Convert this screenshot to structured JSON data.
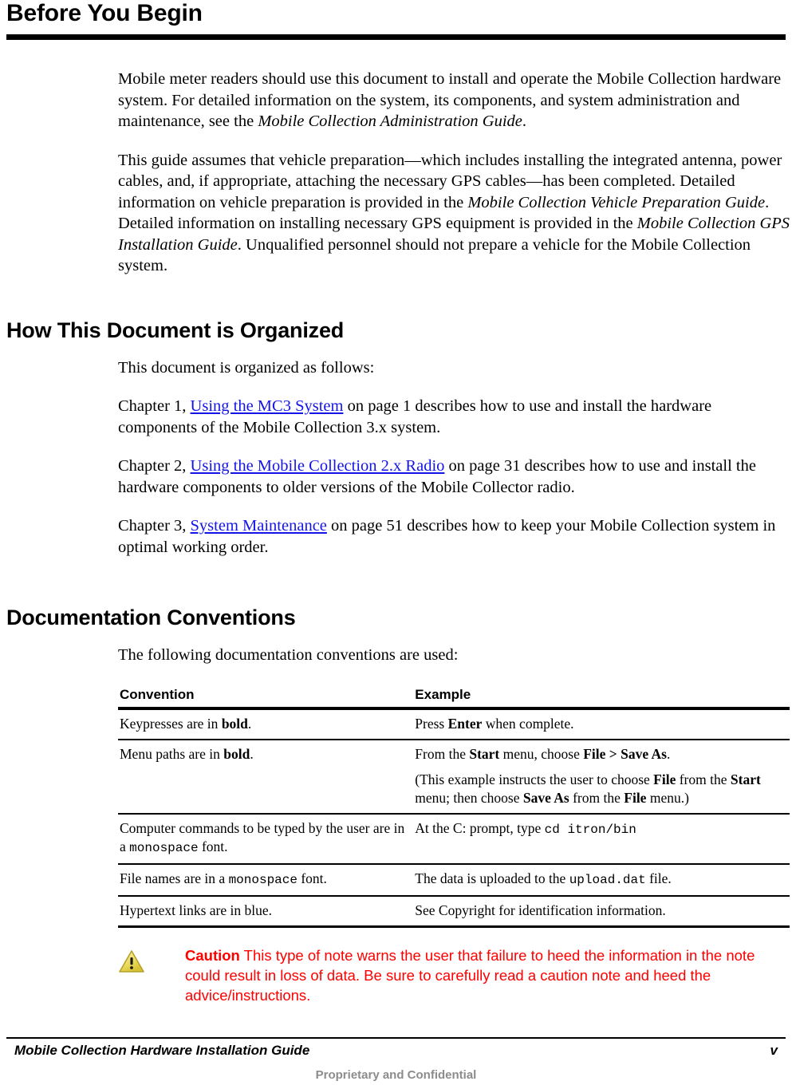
{
  "document": {
    "heading1": "Before You Begin",
    "heading2": "How This Document is Organized",
    "heading3": "Documentation Conventions"
  },
  "intro": {
    "p1_a": "Mobile meter readers should use this document to install and operate the Mobile Collection hardware system. For detailed information on the system, its components, and system administration and maintenance, see the ",
    "p1_italic": "Mobile Collection Administration Guide",
    "p1_b": ".",
    "p2_a": "This guide assumes that vehicle preparation—which includes installing the integrated antenna, power cables, and, if appropriate, attaching the necessary GPS cables—has been completed. Detailed information on vehicle preparation is provided in the ",
    "p2_italic1": "Mobile Collection Vehicle Preparation Guide",
    "p2_b": ". Detailed information on installing necessary GPS equipment is provided in the ",
    "p2_italic2": "Mobile Collection GPS Installation Guide",
    "p2_c": ". Unqualified personnel should not prepare a vehicle for the Mobile Collection system."
  },
  "organized": {
    "intro_line": "This document is organized as follows:",
    "chapters": [
      {
        "prefix": "Chapter 1, ",
        "link": "Using the MC3 System",
        "suffix": " on page 1 describes how to use and install the hardware components of the Mobile Collection 3.x system."
      },
      {
        "prefix": "Chapter 2, ",
        "link": "Using the Mobile Collection 2.x Radio",
        "suffix": " on page 31 describes how to use and install the hardware components to older versions of the Mobile Collector radio."
      },
      {
        "prefix": "Chapter 3, ",
        "link": "System Maintenance",
        "suffix": " on page 51 describes how to keep your Mobile Collection system in optimal working order."
      }
    ]
  },
  "conventions": {
    "intro_line": "The following documentation conventions are used:",
    "columns": [
      "Convention",
      "Example"
    ],
    "rows": [
      {
        "convention": {
          "a": "Keypresses are in ",
          "b": "bold",
          "c": "."
        },
        "example": {
          "a": "Press ",
          "b": "Enter",
          "c": " when complete."
        }
      },
      {
        "convention": {
          "a": "Menu paths are in ",
          "b": "bold",
          "c": "."
        },
        "example": {
          "a": "From the ",
          "b": "Start",
          "c": " menu, choose ",
          "d": "File > Save As",
          "e": ".",
          "sub_a": "(This example instructs the user to choose ",
          "sub_b": "File",
          "sub_c": " from the ",
          "sub_d": "Start",
          "sub_e": " menu; then choose ",
          "sub_f": "Save As",
          "sub_g": " from the ",
          "sub_h": "File",
          "sub_i": " menu.)"
        }
      },
      {
        "convention": {
          "a": "Computer commands to be typed by the user are in a ",
          "mono": "monospace",
          "c": " font."
        },
        "example": {
          "a": "At the C: prompt, type ",
          "mono": "cd itron/bin",
          "c": ""
        }
      },
      {
        "convention": {
          "a": "File names are in a ",
          "mono": "monospace",
          "c": " font."
        },
        "example": {
          "a": "The data is uploaded to the ",
          "mono": "upload.dat",
          "c": " file."
        }
      },
      {
        "convention": {
          "a": "Hypertext links are in blue.",
          "b": "",
          "c": ""
        },
        "example": {
          "a": "See Copyright for identification information.",
          "b": "",
          "c": ""
        }
      }
    ]
  },
  "caution": {
    "icon": "warning-triangle-icon",
    "lead": "Caution",
    "text": " This type of note warns the user that failure to heed the information in the note could result in loss of data. Be sure to carefully read a caution note and heed the advice/instructions.",
    "color": "#ff0000",
    "icon_fill": "#e8d24a"
  },
  "footer": {
    "title": "Mobile Collection Hardware Installation Guide",
    "page_number": "v",
    "confidential": "Proprietary and Confidential"
  }
}
